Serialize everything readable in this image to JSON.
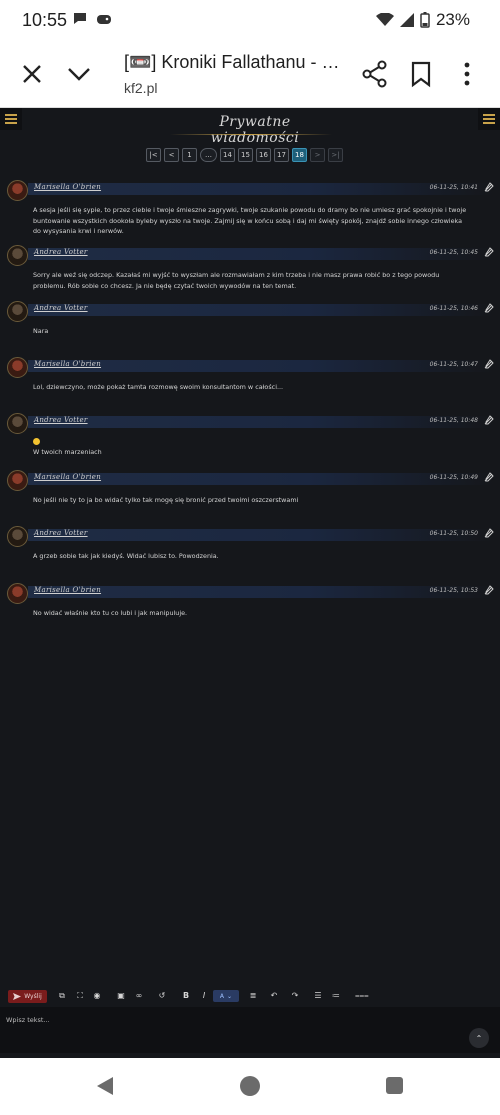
{
  "status_bar": {
    "time": "10:55",
    "battery": "23%"
  },
  "browser": {
    "tab_title": "[📼] Kroniki Fallathanu - …",
    "url": "kf2.pl"
  },
  "page": {
    "title": "Prywatne wiadomości",
    "pagination": [
      "1",
      "…",
      "14",
      "15",
      "16",
      "17",
      "18"
    ],
    "current_page": "18"
  },
  "messages": [
    {
      "author": "Marisella O'brien",
      "time": "06-11-25, 10:41",
      "text": "A sesja jeśli się sypie,  to przez ciebie i twoje śmieszne zagrywki, twoje szukanie powodu do dramy bo nie umiesz grać spokojnie i twoje buntowanie wszystkich dookoła byleby wyszło na twoje. Zajmij się w końcu sobą i daj mi święty spokój, znajdź sobie innego człowieka do wysysania krwi i nerwów."
    },
    {
      "author": "Andrea Votter",
      "time": "06-11-25, 10:45",
      "text": "Sorry ale weź się odczep. Kazałaś mi wyjść to wyszłam ale rozmawiałam z kim trzeba i nie masz prawa robić bo z tego powodu problemu. Rób sobie co chcesz. Ja nie będę czytać twoich wywodów na ten temat."
    },
    {
      "author": "Andrea Votter",
      "time": "06-11-25, 10:46",
      "text": "Nara"
    },
    {
      "author": "Marisella O'brien",
      "time": "06-11-25, 10:47",
      "text": "Lol, dziewczyno, może pokaż tamta rozmowę swoim konsultantom w całości..."
    },
    {
      "author": "Andrea Votter",
      "time": "06-11-25, 10:48",
      "text": "W twoich marzeniach",
      "emoji": true
    },
    {
      "author": "Marisella O'brien",
      "time": "06-11-25, 10:49",
      "text": "No jeśli nie ty to ja bo widać tylko tak mogę się bronić przed twoimi oszczerstwami"
    },
    {
      "author": "Andrea Votter",
      "time": "06-11-25, 10:50",
      "text": "A grzeb sobie tak jak kiedyś. Widać lubisz to. Powodzenia."
    },
    {
      "author": "Marisella O'brien",
      "time": "06-11-25, 10:53",
      "text": "No widać właśnie kto tu co lubi i jak manipuluje."
    }
  ],
  "editor": {
    "send_label": "Wyślij",
    "color_label": "A",
    "placeholder": "Wpisz tekst..."
  },
  "colors": {
    "background": "#15171b",
    "accent_gold": "#c8a24a",
    "send_button": "#7a1c1c",
    "active_page": "#1e5f7a"
  }
}
